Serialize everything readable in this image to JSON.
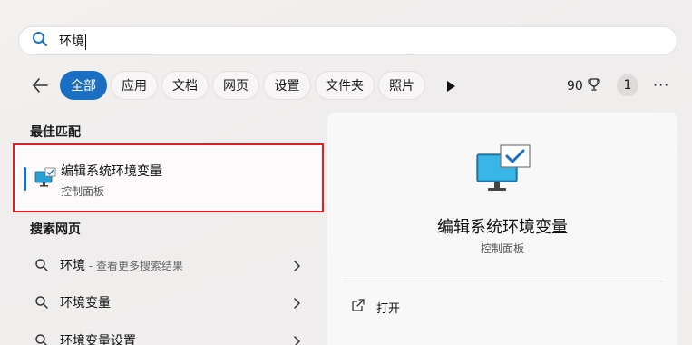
{
  "search": {
    "query": "环境"
  },
  "filters": {
    "tabs": [
      {
        "label": "全部",
        "active": true
      },
      {
        "label": "应用"
      },
      {
        "label": "文档"
      },
      {
        "label": "网页"
      },
      {
        "label": "设置"
      },
      {
        "label": "文件夹"
      },
      {
        "label": "照片"
      }
    ],
    "points": "90",
    "badge": "1"
  },
  "best_match": {
    "section_title": "最佳匹配",
    "title": "编辑系统环境变量",
    "subtitle": "控制面板"
  },
  "web_search": {
    "section_title": "搜索网页",
    "items": [
      {
        "label": "环境",
        "hint": " - 查看更多搜索结果"
      },
      {
        "label": "环境变量",
        "hint": ""
      },
      {
        "label": "环境变量设置",
        "hint": ""
      }
    ]
  },
  "detail": {
    "title": "编辑系统环境变量",
    "subtitle": "控制面板",
    "actions": [
      {
        "label": "打开",
        "icon": "open-external-icon"
      }
    ]
  },
  "colors": {
    "accent": "#1a6fc2",
    "highlight_border": "#e02020"
  }
}
